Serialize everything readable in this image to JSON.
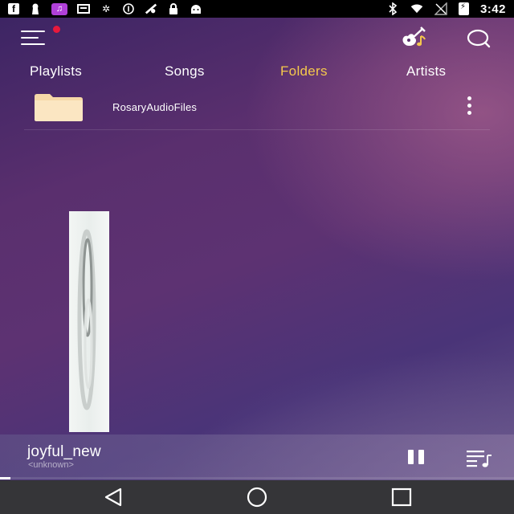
{
  "status_bar": {
    "time": "3:42",
    "icons_left": [
      "facebook-icon",
      "keyhole-icon",
      "music-note-icon",
      "tray-icon",
      "sync-icon",
      "info-icon",
      "fast-sat-icon",
      "lock-icon",
      "android-icon"
    ],
    "icons_right": [
      "bluetooth-icon",
      "wifi-icon",
      "no-signal-icon",
      "battery-charging-icon"
    ],
    "music_icon_color": "#b040d8"
  },
  "header": {
    "menu_icon": "hamburger-menu-icon",
    "notification_dot_color": "#e8193c",
    "guitar_icon": "guitar-icon",
    "search_icon": "search-icon"
  },
  "tabs": [
    {
      "label": "Playlists",
      "active": false
    },
    {
      "label": "Songs",
      "active": false
    },
    {
      "label": "Folders",
      "active": true
    },
    {
      "label": "Artists",
      "active": false
    }
  ],
  "accent_color": "#f5c84c",
  "folders": [
    {
      "name": "RosaryAudioFiles",
      "icon": "folder-icon",
      "menu_icon": "more-vertical-icon"
    }
  ],
  "now_playing": {
    "title": "joyful_new",
    "artist": "<unknown>",
    "pause_icon": "pause-icon",
    "queue_icon": "queue-music-icon",
    "progress": 0.02
  },
  "nav_bar": {
    "back_icon": "back-triangle-icon",
    "home_icon": "home-circle-icon",
    "recents_icon": "recents-square-icon"
  }
}
